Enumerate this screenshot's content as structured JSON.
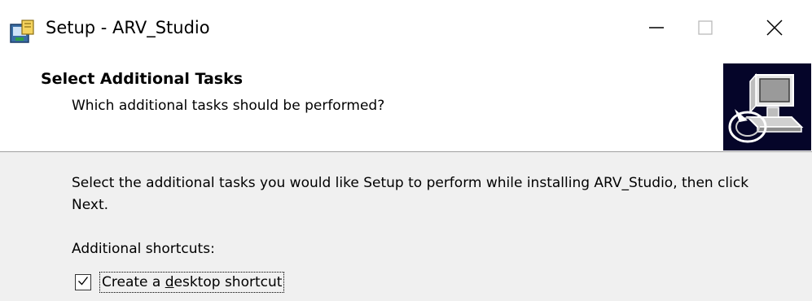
{
  "window": {
    "title": "Setup - ARV_Studio",
    "app_icon": "installer-box-icon",
    "controls": {
      "minimize_icon": "minimize-icon",
      "maximize_icon": "maximize-icon",
      "close_icon": "close-icon"
    }
  },
  "header": {
    "title": "Select Additional Tasks",
    "subtitle": "Which additional tasks should be performed?",
    "image_icon": "computer-install-icon"
  },
  "body": {
    "instruction": "Select the additional tasks you would like Setup to perform while installing ARV_Studio, then click Next.",
    "group_label": "Additional shortcuts:",
    "tasks": [
      {
        "label_before": "Create a ",
        "label_accel": "d",
        "label_after": "esktop shortcut",
        "checked": true
      }
    ]
  },
  "colors": {
    "window_bg": "#f0f0f0",
    "header_bg": "#ffffff",
    "wizard_image_bg": "#050529"
  }
}
